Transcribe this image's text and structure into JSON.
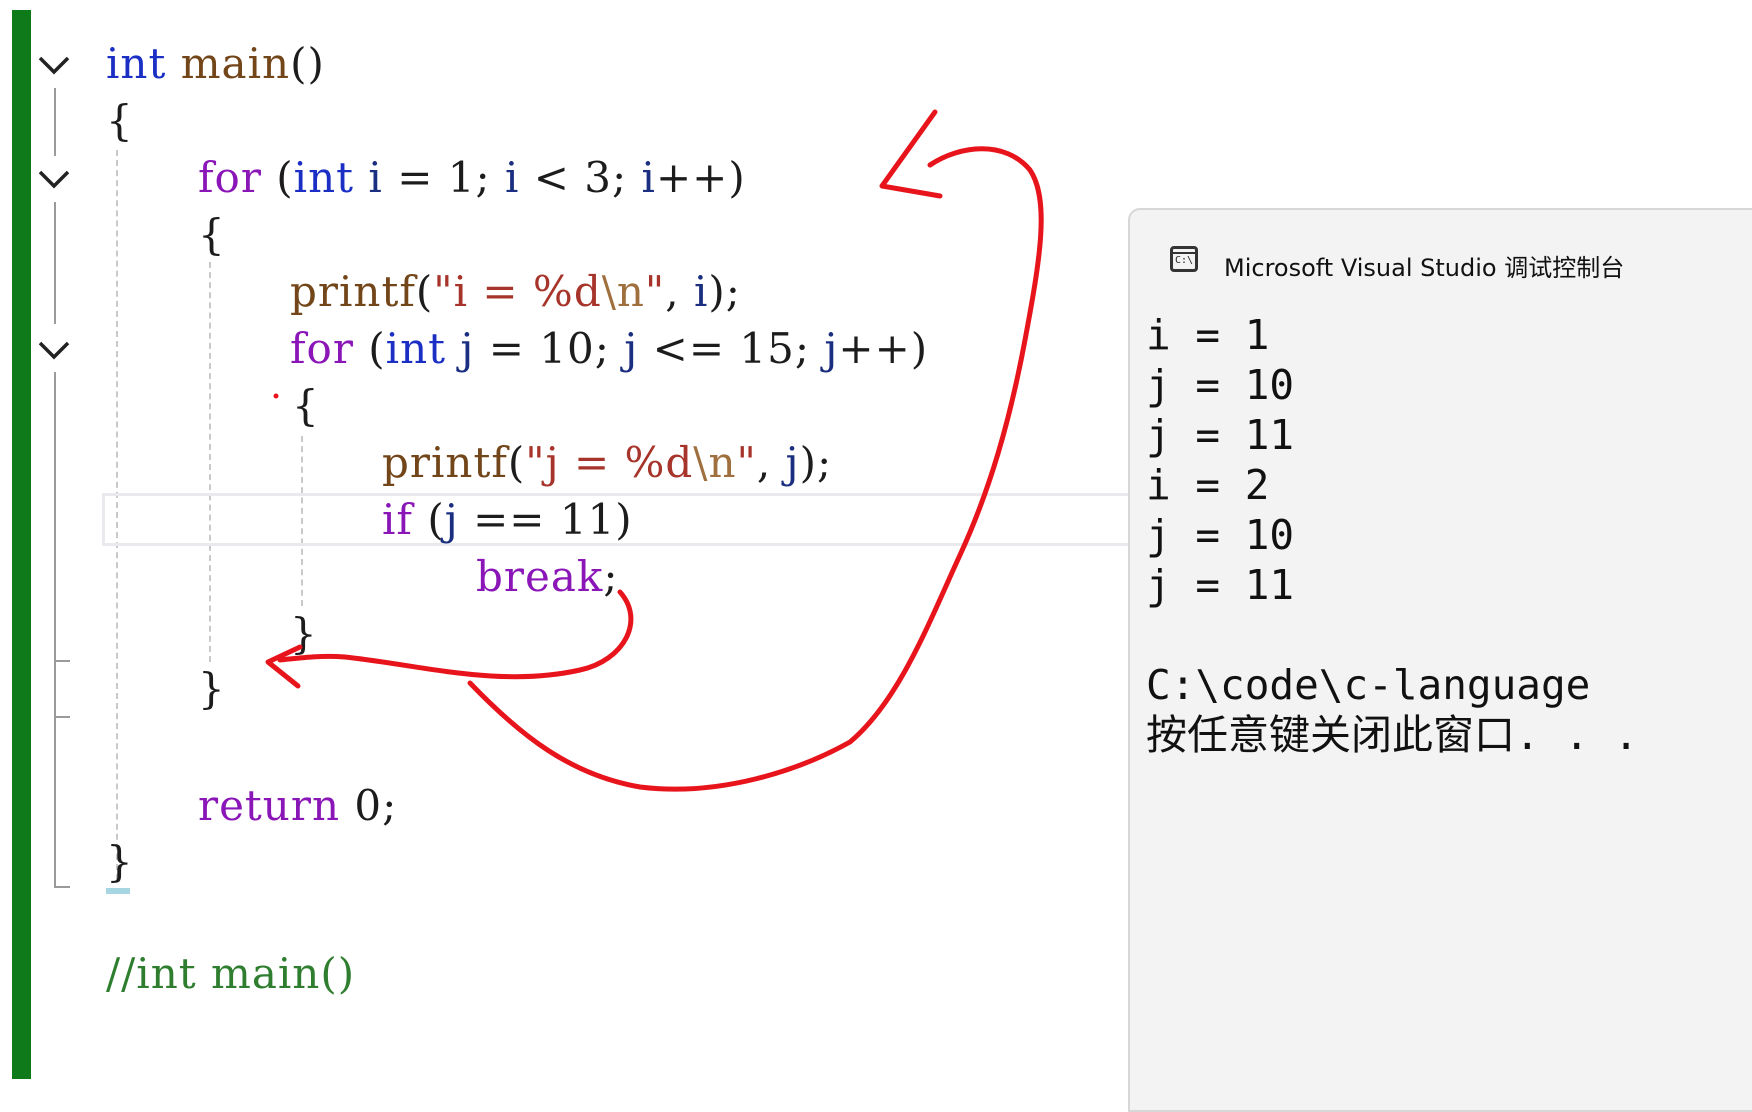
{
  "editor": {
    "lines": [
      {
        "t": [
          {
            "s": "int",
            "c": "kw"
          },
          {
            "s": " "
          },
          {
            "s": "main",
            "c": "fn"
          },
          {
            "s": "()",
            "c": "plain"
          }
        ]
      },
      {
        "t": [
          {
            "s": "{",
            "c": "plain"
          }
        ]
      },
      {
        "t": [
          {
            "s": "for",
            "c": "flow"
          },
          {
            "s": " (",
            "c": "plain"
          },
          {
            "s": "int",
            "c": "kw"
          },
          {
            "s": " "
          },
          {
            "s": "i",
            "c": "var"
          },
          {
            "s": " = 1; ",
            "c": "plain"
          },
          {
            "s": "i",
            "c": "var"
          },
          {
            "s": " < 3; ",
            "c": "plain"
          },
          {
            "s": "i",
            "c": "var"
          },
          {
            "s": "++)",
            "c": "plain"
          }
        ]
      },
      {
        "t": [
          {
            "s": "{",
            "c": "plain"
          }
        ]
      },
      {
        "t": [
          {
            "s": "printf",
            "c": "fn"
          },
          {
            "s": "(",
            "c": "plain"
          },
          {
            "s": "\"i = %d",
            "c": "str"
          },
          {
            "s": "\\n",
            "c": "esc"
          },
          {
            "s": "\"",
            "c": "str"
          },
          {
            "s": ", ",
            "c": "plain"
          },
          {
            "s": "i",
            "c": "var"
          },
          {
            "s": ");",
            "c": "plain"
          }
        ]
      },
      {
        "t": [
          {
            "s": "for",
            "c": "flow"
          },
          {
            "s": " (",
            "c": "plain"
          },
          {
            "s": "int",
            "c": "kw"
          },
          {
            "s": " "
          },
          {
            "s": "j",
            "c": "var"
          },
          {
            "s": " = 10; ",
            "c": "plain"
          },
          {
            "s": "j",
            "c": "var"
          },
          {
            "s": " <= 15; ",
            "c": "plain"
          },
          {
            "s": "j",
            "c": "var"
          },
          {
            "s": "++)",
            "c": "plain"
          }
        ]
      },
      {
        "t": [
          {
            "s": "{",
            "c": "plain"
          }
        ]
      },
      {
        "t": [
          {
            "s": "printf",
            "c": "fn"
          },
          {
            "s": "(",
            "c": "plain"
          },
          {
            "s": "\"j = %d",
            "c": "str"
          },
          {
            "s": "\\n",
            "c": "esc"
          },
          {
            "s": "\"",
            "c": "str"
          },
          {
            "s": ", ",
            "c": "plain"
          },
          {
            "s": "j",
            "c": "var"
          },
          {
            "s": ");",
            "c": "plain"
          }
        ]
      },
      {
        "t": [
          {
            "s": "if",
            "c": "flow"
          },
          {
            "s": " (",
            "c": "plain"
          },
          {
            "s": "j",
            "c": "var"
          },
          {
            "s": " == 11)",
            "c": "plain"
          }
        ]
      },
      {
        "t": [
          {
            "s": "break",
            "c": "flow"
          },
          {
            "s": ";",
            "c": "plain"
          }
        ]
      },
      {
        "t": [
          {
            "s": "}",
            "c": "plain"
          }
        ]
      },
      {
        "t": [
          {
            "s": "}",
            "c": "plain"
          }
        ]
      },
      {
        "t": [
          {
            "s": "return",
            "c": "flow"
          },
          {
            "s": " 0;",
            "c": "plain"
          }
        ]
      },
      {
        "t": [
          {
            "s": "}",
            "c": "plain"
          }
        ]
      },
      {
        "t": [
          {
            "s": "//int main()",
            "c": "comment"
          }
        ]
      }
    ]
  },
  "console": {
    "title": "Microsoft Visual Studio 调试控制台",
    "icon": "console-icon",
    "icon_text": "C:\\",
    "output": [
      "i = 1",
      "j = 10",
      "j = 11",
      "i = 2",
      "j = 10",
      "j = 11",
      "",
      "C:\\code\\c-language",
      "按任意键关闭此窗口. . ."
    ]
  },
  "annotations": {
    "color": "#e8141c"
  },
  "colors": {
    "change_bar": "#0f7a19"
  }
}
